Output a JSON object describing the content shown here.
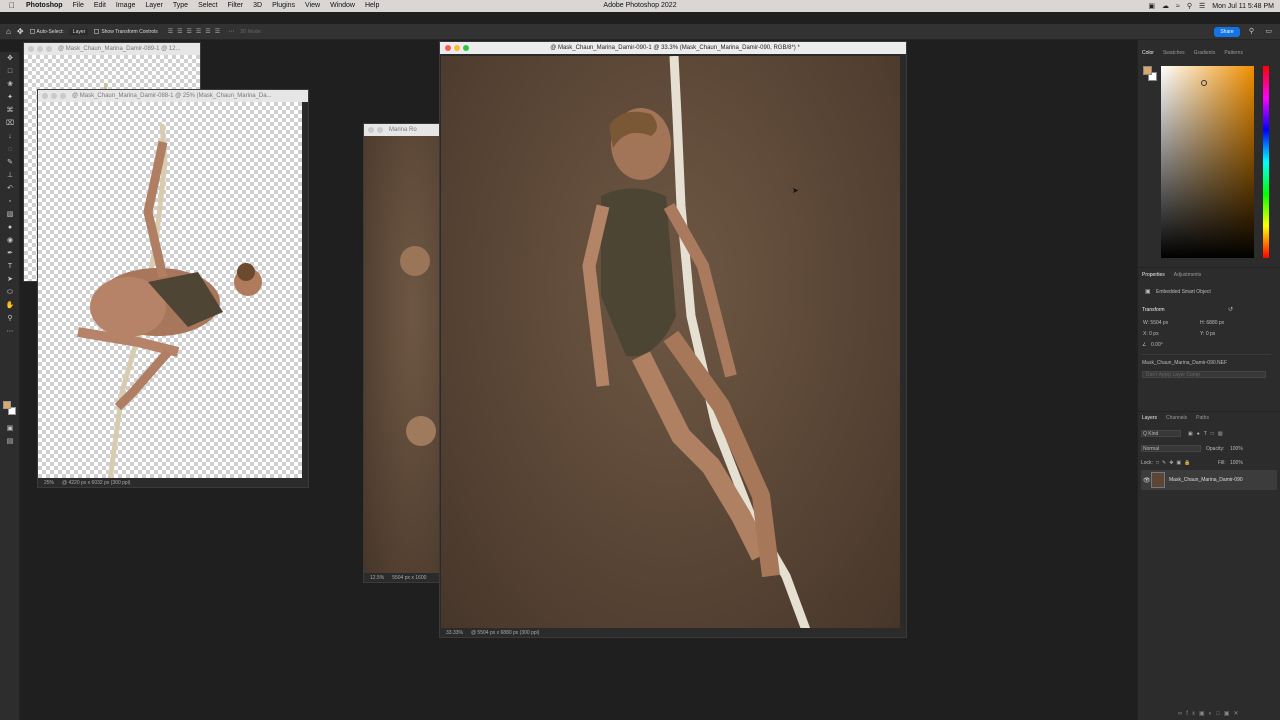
{
  "menubar": {
    "apple": "",
    "app_name": "Photoshop",
    "items": [
      "File",
      "Edit",
      "Image",
      "Layer",
      "Type",
      "Select",
      "Filter",
      "3D",
      "Plugins",
      "View",
      "Window",
      "Help"
    ],
    "window_title": "Adobe Photoshop 2022",
    "datetime": "Mon Jul 11  5:48 PM"
  },
  "options_bar": {
    "auto_select": "Auto-Select:",
    "auto_select_target": "Layer",
    "show_transform": "Show Transform Controls",
    "mode_3d": "3D Mode:",
    "share": "Share"
  },
  "documents": {
    "doc1": {
      "title": "@ Mask_Chaun_Marina_Damir-089-1 @ 12..."
    },
    "doc2": {
      "title": "@ Mask_Chaun_Marina_Damir-088-1 @ 25% (Mask_Chaun_Marina_Da...",
      "zoom": "25%",
      "info": "@ 4220 px x 6032 px (300 ppi)"
    },
    "doc3": {
      "title": "Marina Ro",
      "zoom": "12.5%",
      "info": "5504 px x 1600"
    },
    "doc4": {
      "title": "@ Mask_Chaun_Marina_Damir-090-1 @ 33.3% (Mask_Chaun_Marina_Damir-090, RGB/8*) *",
      "zoom": "33.33%",
      "info": "@ 5504 px x 6880 px (300 ppi)"
    }
  },
  "color_panel": {
    "tabs": [
      "Color",
      "Swatches",
      "Gradients",
      "Patterns"
    ],
    "foreground": "#d9a86a",
    "background": "#ffffff"
  },
  "properties_panel": {
    "tabs": [
      "Properties",
      "Adjustments"
    ],
    "type": "Embedded Smart Object",
    "transform_label": "Transform",
    "w": "W: 5504 px",
    "h": "H: 6880 px",
    "x": "X: 0 px",
    "y": "Y: 0 px",
    "angle": "0.00°",
    "filename": "Mask_Chaun_Marina_Damir-090.NEF",
    "button": "Don't Apply Layer Comp"
  },
  "layers_panel": {
    "tabs": [
      "Layers",
      "Channels",
      "Paths"
    ],
    "kind": "Q Kind",
    "blend_mode": "Normal",
    "opacity_label": "Opacity:",
    "opacity": "100%",
    "lock_label": "Lock:",
    "fill_label": "Fill:",
    "fill": "100%",
    "layer_name": "Mask_Chaun_Marina_Damir-090"
  }
}
